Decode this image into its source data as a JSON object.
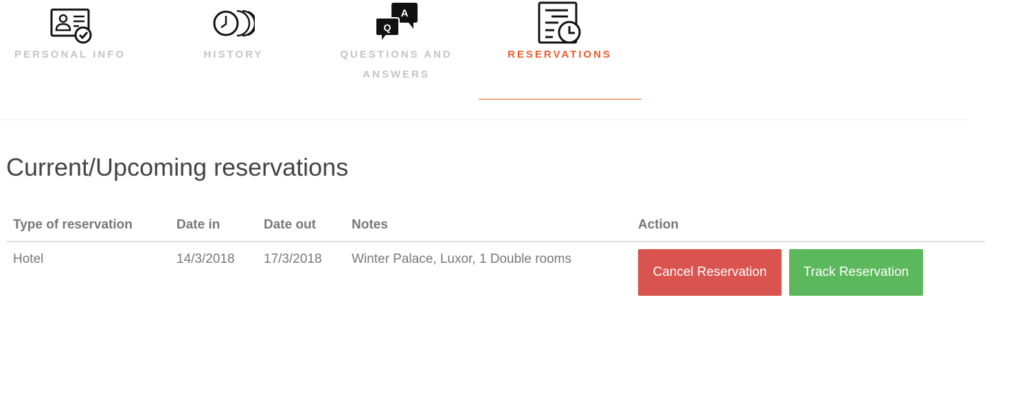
{
  "tabs": [
    {
      "label": "PERSONAL INFO",
      "icon": "id-card-check-icon",
      "active": false
    },
    {
      "label": "HISTORY",
      "icon": "clock-history-icon",
      "active": false
    },
    {
      "label": "QUESTIONS AND\nANSWERS",
      "icon": "qa-bubbles-icon",
      "active": false
    },
    {
      "label": "RESERVATIONS",
      "icon": "document-clock-icon",
      "active": true
    }
  ],
  "colors": {
    "accent": "#f05a28",
    "cancel": "#d9534f",
    "track": "#5cb85c",
    "tab_inactive": "#c4c4c4"
  },
  "section": {
    "title": "Current/Upcoming reservations"
  },
  "table": {
    "headers": [
      "Type of reservation",
      "Date in",
      "Date out",
      "Notes",
      "Action"
    ],
    "rows": [
      {
        "type": "Hotel",
        "date_in": "14/3/2018",
        "date_out": "17/3/2018",
        "notes": "Winter Palace, Luxor, 1 Double rooms",
        "cancel_label": "Cancel Reservation",
        "track_label": "Track Reservation"
      }
    ]
  }
}
